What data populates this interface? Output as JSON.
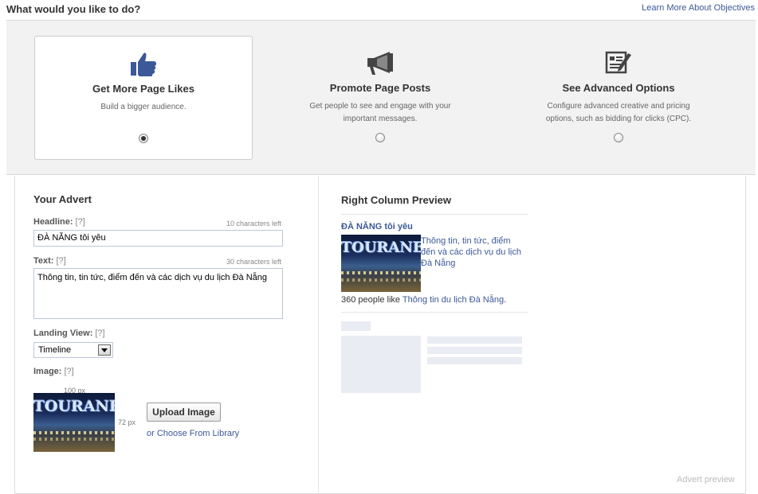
{
  "header": {
    "title": "What would you like to do?",
    "learn_more": "Learn More About Objectives"
  },
  "objectives": [
    {
      "title": "Get More Page Likes",
      "desc": "Build a bigger audience.",
      "desc2": "",
      "icon": "thumbs-up-icon",
      "selected": true
    },
    {
      "title": "Promote Page Posts",
      "desc": "Get people to see and engage with your",
      "desc2": "important messages.",
      "icon": "megaphone-icon",
      "selected": false
    },
    {
      "title": "See Advanced Options",
      "desc": "Configure advanced creative and pricing",
      "desc2": "options, such as bidding for clicks (CPC).",
      "icon": "advanced-options-icon",
      "selected": false
    }
  ],
  "advert": {
    "section_title": "Your Advert",
    "headline_label": "Headline:",
    "help": "[?]",
    "headline_chars_left": "10 characters left",
    "headline_value": "ĐÀ NẴNG tôi yêu",
    "text_label": "Text:",
    "text_chars_left": "30 characters left",
    "text_value": "Thông tin, tin tức, điểm đến và các dịch vụ du lịch Đà Nẵng",
    "landing_label": "Landing View:",
    "landing_value": "Timeline",
    "image_label": "Image:",
    "image_width": "100 px",
    "image_height": "72 px",
    "upload_button": "Upload Image",
    "choose_library": "or Choose From Library",
    "thumb_logo": "TOURANE"
  },
  "preview": {
    "section_title": "Right Column Preview",
    "headline": "ĐÀ NẴNG tôi yêu",
    "body": "Thông tin, tin tức, điểm đến và các dịch vụ du lịch Đà Nẵng",
    "likes_prefix": "360 people like ",
    "likes_page": "Thông tin du lịch Đà Nẵng",
    "likes_suffix": ".",
    "footer": "Advert preview"
  },
  "colors": {
    "link": "#3b5998",
    "panel_bg": "#f2f2f2"
  }
}
